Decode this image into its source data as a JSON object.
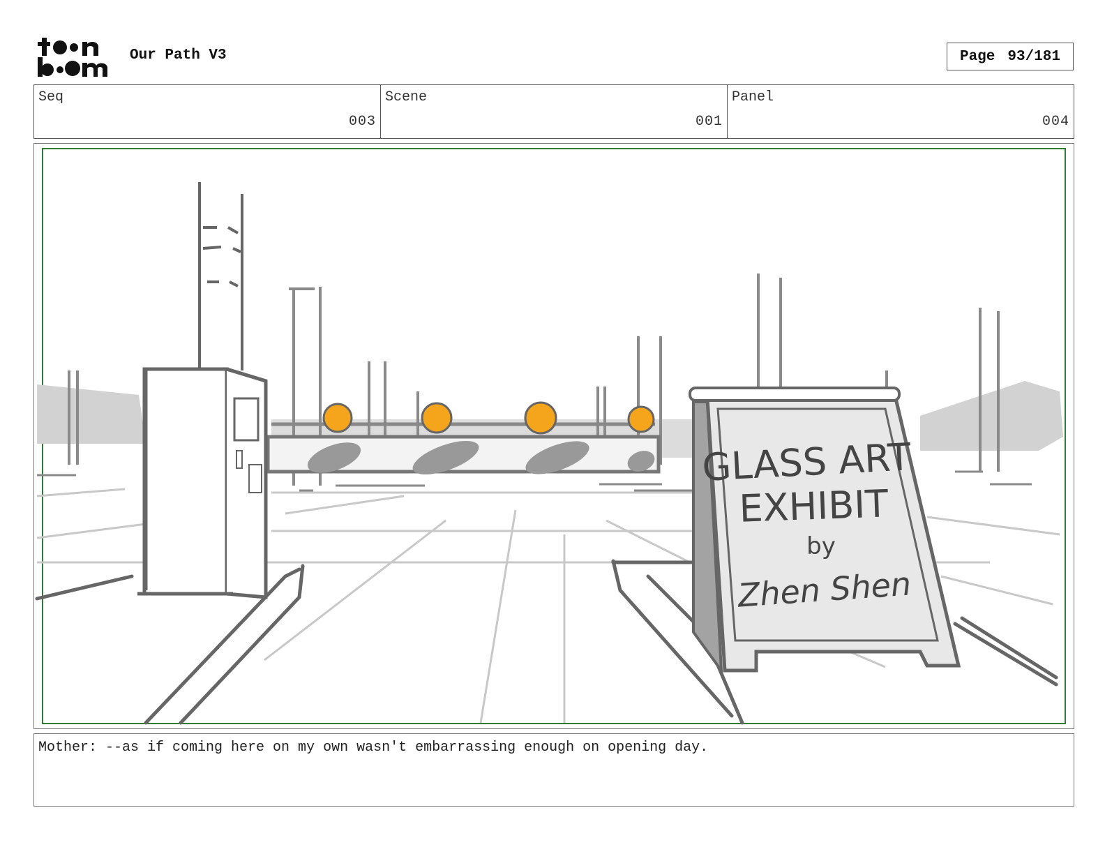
{
  "header": {
    "logo_text": "toon boom",
    "project_title": "Our Path V3",
    "page_label": "Page",
    "page_number": "93/181"
  },
  "info": {
    "seq": {
      "label": "Seq",
      "value": "003"
    },
    "scene": {
      "label": "Scene",
      "value": "001"
    },
    "panel": {
      "label": "Panel",
      "value": "004"
    }
  },
  "panel_art": {
    "sign_lines": [
      "GLASS ART",
      "EXHIBIT",
      "by",
      "Zhen Shen"
    ],
    "colors": {
      "safe_frame": "#2e7d32",
      "lamp": "#f5a51b",
      "sketch_dark": "#6b6b6b",
      "sketch_light": "#c8c8c8"
    }
  },
  "dialogue": {
    "text": "Mother: --as if coming here on my own wasn't embarrassing enough on opening day."
  }
}
